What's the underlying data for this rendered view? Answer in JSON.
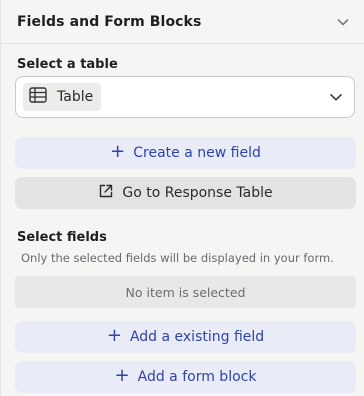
{
  "header": {
    "title": "Fields and Form Blocks",
    "collapse_icon": "chevron-down-icon"
  },
  "table_select": {
    "label": "Select a table",
    "value": "Table",
    "icon": "table-icon",
    "dropdown_icon": "chevron-down-icon"
  },
  "buttons": {
    "create_field": "Create a new field",
    "go_to_response": "Go to Response Table",
    "add_existing_field": "Add a existing field",
    "add_form_block": "Add a form block"
  },
  "fields": {
    "label": "Select fields",
    "hint": "Only the selected fields will be displayed in your form.",
    "empty_text": "No item is selected"
  },
  "colors": {
    "accent": "#2f43a8",
    "accent_bg": "#e9ebf7",
    "panel_bg": "#f5f5f4"
  }
}
